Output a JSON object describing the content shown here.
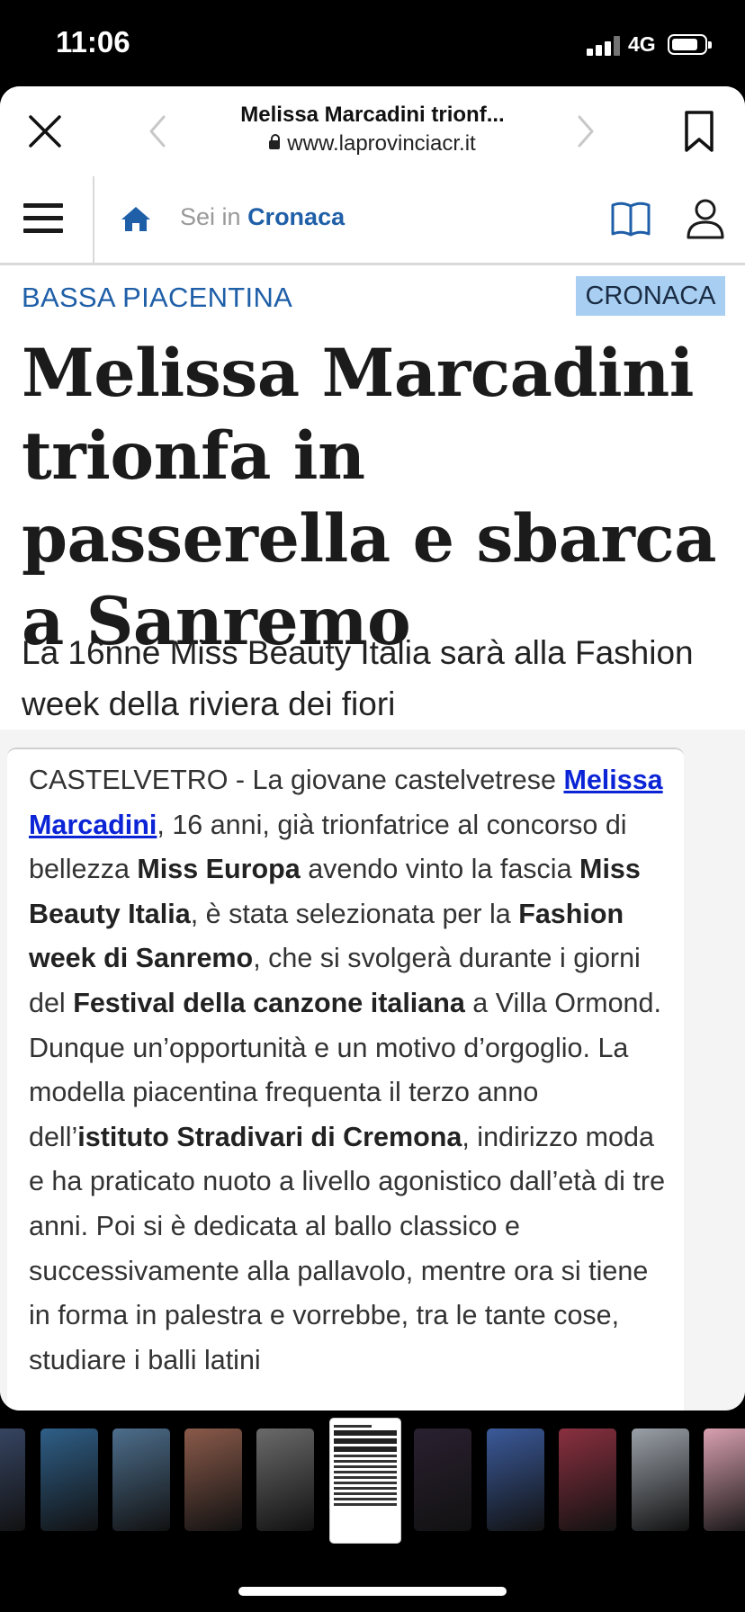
{
  "status_bar": {
    "time": "11:06",
    "network": "4G"
  },
  "browser": {
    "page_title": "Melissa Marcadini trionf...",
    "url": "www.laprovinciacr.it"
  },
  "site_nav": {
    "prefix": "Sei in",
    "section": "Cronaca"
  },
  "article": {
    "kicker": "BASSA PIACENTINA",
    "section_tag": "CRONACA",
    "headline": "Melissa Marcadini trionfa in passerella e sbarca a Sanremo",
    "subhead": "La 16nne Miss Beauty Italia sarà alla Fashion week della riviera dei fiori",
    "body": {
      "p1": "CASTELVETRO - La giovane castelvetrese ",
      "link": "Melissa Marcadini",
      "p2": ", 16 anni, già trionfatrice al concorso di bellezza ",
      "b1": "Miss Europa",
      "p3": " avendo vinto la fascia ",
      "b2": "Miss Beauty Italia",
      "p4": ", è stata selezionata per la ",
      "b3": "Fashion week di Sanremo",
      "p5": ", che si svolgerà durante i giorni del ",
      "b4": "Festival della canzone italiana",
      "p6": " a Villa Ormond. Dunque un’opportunità e un motivo d’orgoglio. La modella piacentina frequenta il terzo anno dell’",
      "b5": "istituto Stradivari di Cremona",
      "p7": ", indirizzo moda e ha praticato nuoto a livello agonistico dall’età di tre anni. Poi si è dedicata al ballo classico e successivamente alla pallavolo, mentre ora si tiene in forma in palestra e vorrebbe, tra le tante cose, studiare i balli latini"
    }
  },
  "colors": {
    "link": "#0b24d6",
    "kicker": "#1f5fa8",
    "tag_bg": "#a8cef1"
  },
  "thumbnails": [
    {
      "name": "photo-thumb-1",
      "color": "#3a4a6a"
    },
    {
      "name": "photo-thumb-2",
      "color": "#2f5f88"
    },
    {
      "name": "photo-thumb-3",
      "color": "#4d6e8c"
    },
    {
      "name": "photo-thumb-4",
      "color": "#8a5a4a"
    },
    {
      "name": "photo-thumb-5",
      "color": "#6a6a6a"
    },
    {
      "name": "screenshot-thumb-active",
      "color": "#ffffff"
    },
    {
      "name": "photo-thumb-7",
      "color": "#2a2030"
    },
    {
      "name": "photo-thumb-8",
      "color": "#3b5a9a"
    },
    {
      "name": "photo-thumb-9",
      "color": "#8a3040"
    },
    {
      "name": "photo-thumb-10",
      "color": "#9aa0a8"
    },
    {
      "name": "photo-thumb-11",
      "color": "#d8a0b0"
    }
  ]
}
